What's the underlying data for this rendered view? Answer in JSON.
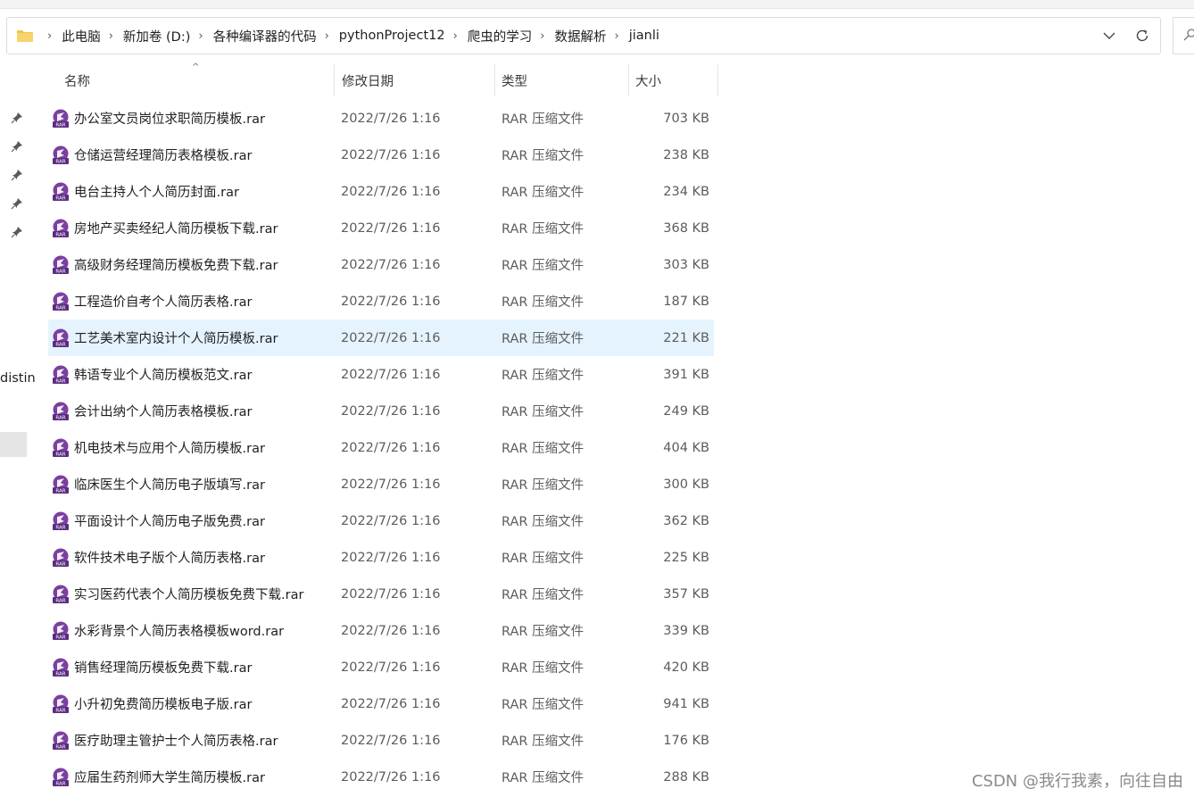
{
  "breadcrumb": {
    "items": [
      "此电脑",
      "新加卷 (D:)",
      "各种编译器的代码",
      "pythonProject12",
      "爬虫的学习",
      "数据解析",
      "jianli"
    ]
  },
  "columns": {
    "name": "名称",
    "date": "修改日期",
    "type": "类型",
    "size": "大小"
  },
  "nav_pane": {
    "cut_text": "distin"
  },
  "files": [
    {
      "name": "办公室文员岗位求职简历模板.rar",
      "date": "2022/7/26 1:16",
      "type": "RAR 压缩文件",
      "size": "703 KB"
    },
    {
      "name": "仓储运营经理简历表格模板.rar",
      "date": "2022/7/26 1:16",
      "type": "RAR 压缩文件",
      "size": "238 KB"
    },
    {
      "name": "电台主持人个人简历封面.rar",
      "date": "2022/7/26 1:16",
      "type": "RAR 压缩文件",
      "size": "234 KB"
    },
    {
      "name": "房地产买卖经纪人简历模板下载.rar",
      "date": "2022/7/26 1:16",
      "type": "RAR 压缩文件",
      "size": "368 KB"
    },
    {
      "name": "高级财务经理简历模板免费下载.rar",
      "date": "2022/7/26 1:16",
      "type": "RAR 压缩文件",
      "size": "303 KB"
    },
    {
      "name": "工程造价自考个人简历表格.rar",
      "date": "2022/7/26 1:16",
      "type": "RAR 压缩文件",
      "size": "187 KB"
    },
    {
      "name": "工艺美术室内设计个人简历模板.rar",
      "date": "2022/7/26 1:16",
      "type": "RAR 压缩文件",
      "size": "221 KB",
      "selected": true
    },
    {
      "name": "韩语专业个人简历模板范文.rar",
      "date": "2022/7/26 1:16",
      "type": "RAR 压缩文件",
      "size": "391 KB"
    },
    {
      "name": "会计出纳个人简历表格模板.rar",
      "date": "2022/7/26 1:16",
      "type": "RAR 压缩文件",
      "size": "249 KB"
    },
    {
      "name": "机电技术与应用个人简历模板.rar",
      "date": "2022/7/26 1:16",
      "type": "RAR 压缩文件",
      "size": "404 KB"
    },
    {
      "name": "临床医生个人简历电子版填写.rar",
      "date": "2022/7/26 1:16",
      "type": "RAR 压缩文件",
      "size": "300 KB"
    },
    {
      "name": "平面设计个人简历电子版免费.rar",
      "date": "2022/7/26 1:16",
      "type": "RAR 压缩文件",
      "size": "362 KB"
    },
    {
      "name": "软件技术电子版个人简历表格.rar",
      "date": "2022/7/26 1:16",
      "type": "RAR 压缩文件",
      "size": "225 KB"
    },
    {
      "name": "实习医药代表个人简历模板免费下载.rar",
      "date": "2022/7/26 1:16",
      "type": "RAR 压缩文件",
      "size": "357 KB"
    },
    {
      "name": "水彩背景个人简历表格模板word.rar",
      "date": "2022/7/26 1:16",
      "type": "RAR 压缩文件",
      "size": "339 KB"
    },
    {
      "name": "销售经理简历模板免费下载.rar",
      "date": "2022/7/26 1:16",
      "type": "RAR 压缩文件",
      "size": "420 KB"
    },
    {
      "name": "小升初免费简历模板电子版.rar",
      "date": "2022/7/26 1:16",
      "type": "RAR 压缩文件",
      "size": "941 KB"
    },
    {
      "name": "医疗助理主管护士个人简历表格.rar",
      "date": "2022/7/26 1:16",
      "type": "RAR 压缩文件",
      "size": "176 KB"
    },
    {
      "name": "应届生药剂师大学生简历模板.rar",
      "date": "2022/7/26 1:16",
      "type": "RAR 压缩文件",
      "size": "288 KB"
    }
  ],
  "watermark": "CSDN @我行我素，向往自由",
  "icons": {
    "folder": "folder-icon",
    "file": "rar-archive-icon",
    "dropdown": "chevron-down-icon",
    "refresh": "refresh-icon",
    "pin": "pin-icon"
  },
  "colors": {
    "selected_row": "#e5f3ff",
    "rar_purple": "#7b3fa0",
    "folder_yellow": "#f2c14e"
  }
}
